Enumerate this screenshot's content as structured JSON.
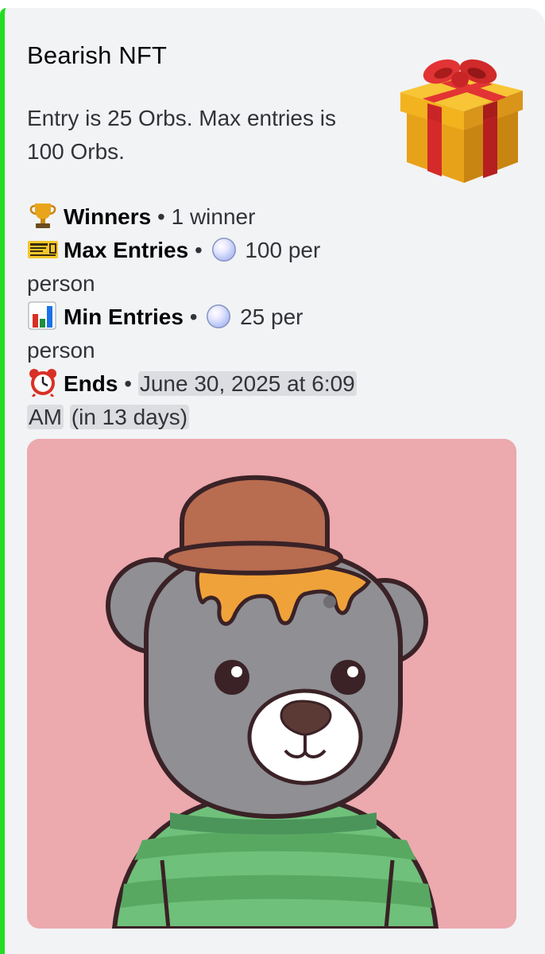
{
  "embed": {
    "accent_color": "#22dd22",
    "title": "Bearish NFT",
    "description": "Entry is 25 Orbs. Max entries is 100 Orbs.",
    "thumbnail_icon": "wrapped-gift-icon"
  },
  "fields": {
    "winners": {
      "icon": "trophy-icon",
      "label": "Winners",
      "separator": "•",
      "value": "1 winner"
    },
    "max_entries": {
      "icon": "ticket-icon",
      "label": "Max Entries",
      "separator": "•",
      "orb_icon": "orb-icon",
      "value": "100 per person"
    },
    "min_entries": {
      "icon": "bar-chart-icon",
      "label": "Min Entries",
      "separator": "•",
      "orb_icon": "orb-icon",
      "value": "25 per person"
    },
    "ends": {
      "icon": "alarm-clock-icon",
      "label": "Ends",
      "separator": "•",
      "timestamp": "June 30, 2025 at 6:09 AM",
      "relative": "(in 13 days)"
    }
  },
  "image": {
    "subject": "gray bear with brown hat and green striped sweater",
    "background_color": "#eca9ae"
  }
}
